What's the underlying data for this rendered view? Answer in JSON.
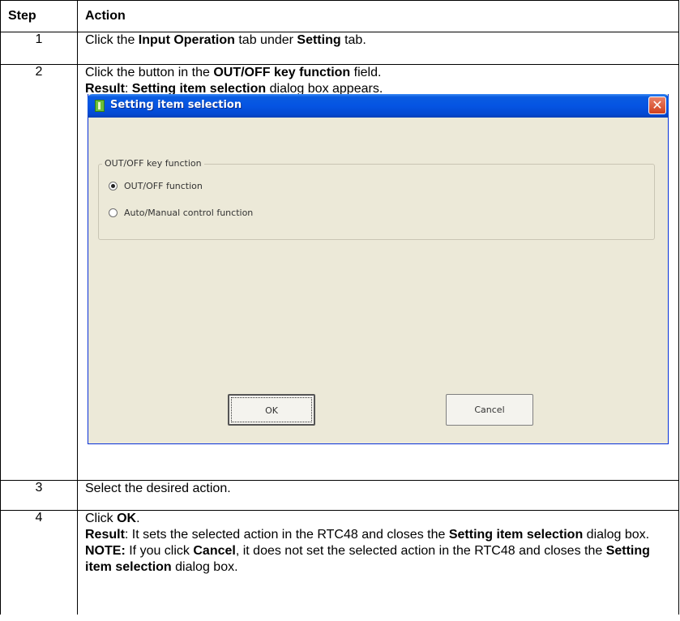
{
  "table": {
    "header": {
      "step": "Step",
      "action": "Action"
    },
    "rows": [
      {
        "step": "1",
        "parts": [
          "Click the ",
          "Input Operation",
          " tab under ",
          "Setting",
          " tab."
        ]
      },
      {
        "step": "2",
        "line1": [
          "Click the button in the ",
          "OUT/OFF key function",
          " field."
        ],
        "line2": [
          "Result",
          ": ",
          "Setting item selection",
          " dialog box appears."
        ]
      },
      {
        "step": "3",
        "text": "Select the desired action."
      },
      {
        "step": "4",
        "line1": [
          "Click ",
          "OK",
          "."
        ],
        "line2": [
          "Result",
          ": It sets the selected action in the RTC48 and closes the ",
          "Setting item selection",
          " dialog box."
        ],
        "line3": [
          "NOTE:",
          " If you click ",
          "Cancel",
          ", it does not set the selected action in the RTC48 and closes the ",
          "Setting item selection",
          " dialog box."
        ]
      }
    ]
  },
  "dialog": {
    "title": "Setting item selection",
    "close_glyph": "✕",
    "group_label": "OUT/OFF key function",
    "options": [
      {
        "label": "OUT/OFF function",
        "selected": true
      },
      {
        "label": "Auto/Manual control function",
        "selected": false
      }
    ],
    "ok_label": "OK",
    "cancel_label": "Cancel"
  }
}
